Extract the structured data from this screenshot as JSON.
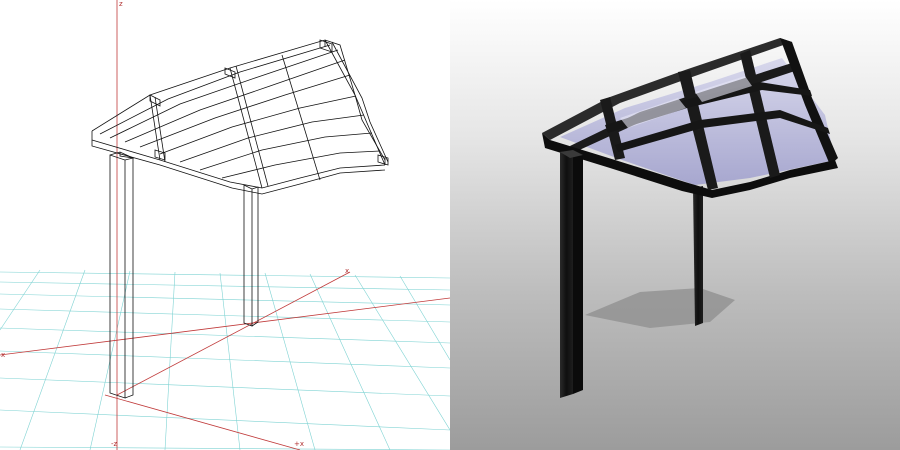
{
  "viewports": [
    {
      "id": "wireframe",
      "kind": "wireframe-view",
      "background": "#ffffff",
      "grid_color": "#7fd3d3",
      "axis_color": "#c03a3a",
      "line_color": "#111111"
    },
    {
      "id": "render",
      "kind": "shaded-render-view",
      "frame_color": "#1c1c1c",
      "panel_color": "#b7b7d8"
    }
  ],
  "axis_labels": {
    "top": "z",
    "right": "x",
    "left": "x",
    "bottom_left": "-z",
    "bottom_right": "+x"
  },
  "icons": {
    "wire_model": "carport-wireframe",
    "render_model": "carport-shaded"
  }
}
